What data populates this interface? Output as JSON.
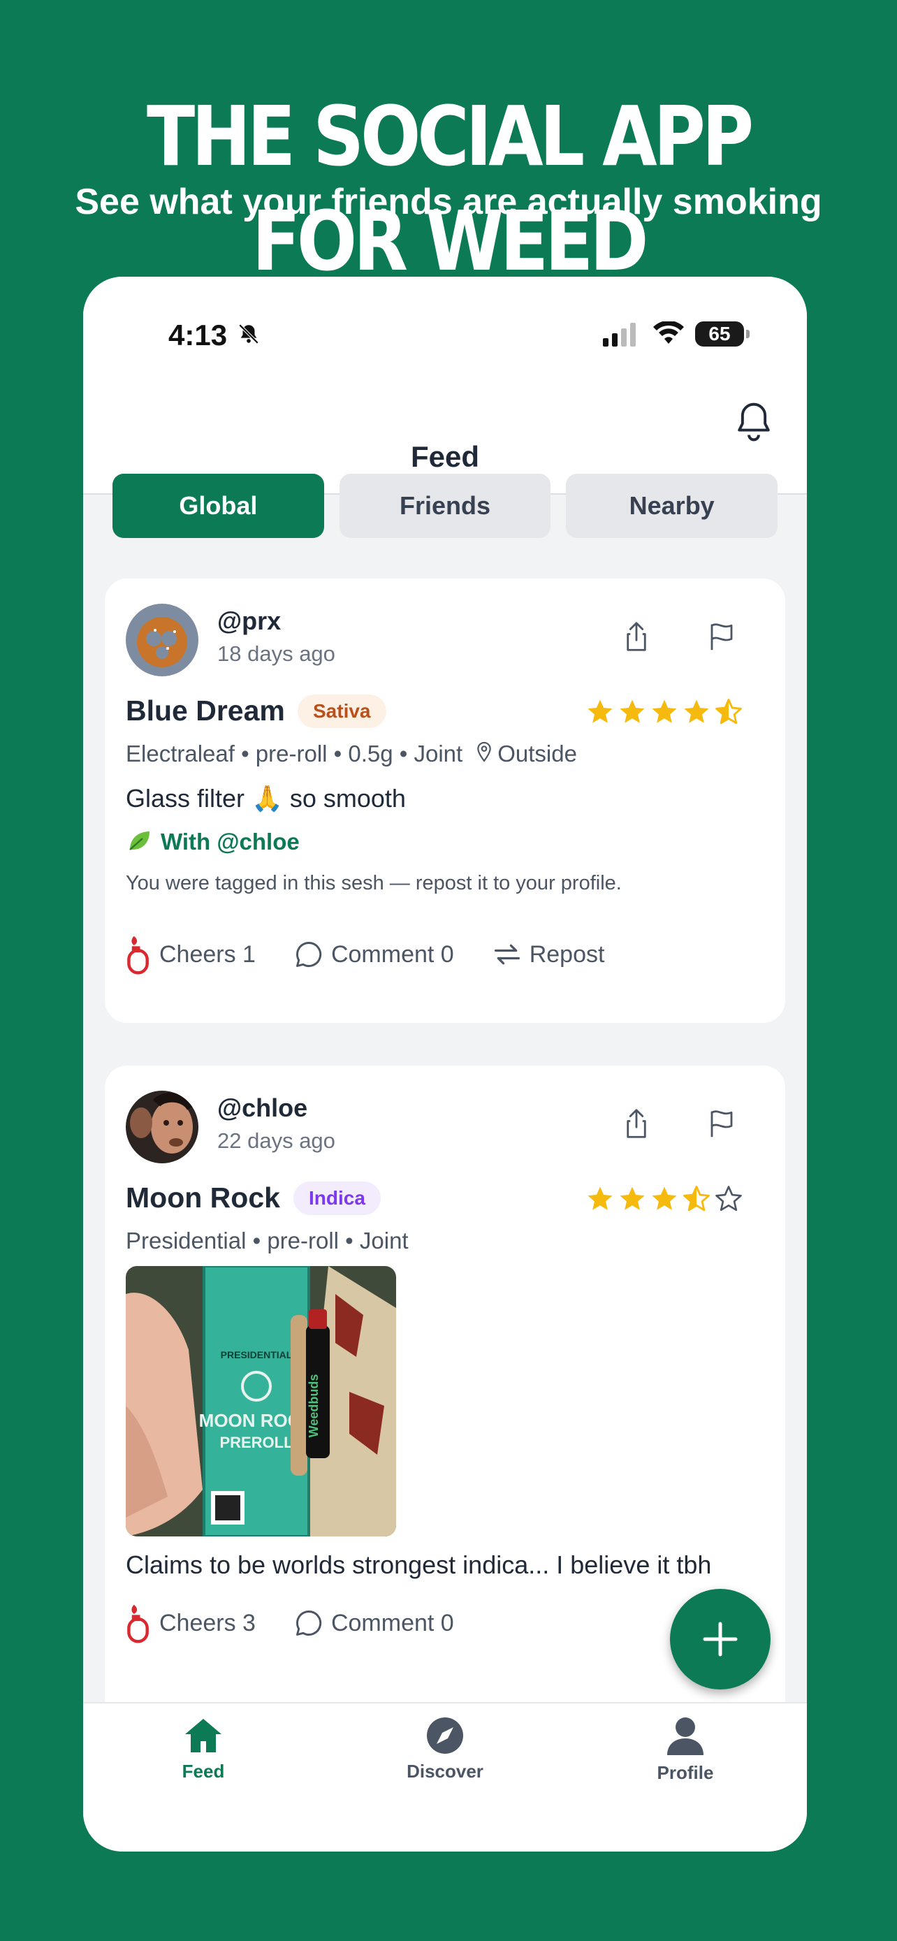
{
  "hero": {
    "title": "THE SOCIAL APP FOR WEED",
    "subtitle": "See what your friends are actually smoking"
  },
  "status_bar": {
    "time": "4:13",
    "battery": "65"
  },
  "header": {
    "title": "Feed"
  },
  "tabs": [
    {
      "label": "Global",
      "active": true
    },
    {
      "label": "Friends",
      "active": false
    },
    {
      "label": "Nearby",
      "active": false
    }
  ],
  "posts": [
    {
      "username": "@prx",
      "time_ago": "18 days ago",
      "strain": "Blue Dream",
      "type_badge": "Sativa",
      "rating": 4.5,
      "meta": "Electraleaf • pre-roll • 0.5g • Joint",
      "location": "Outside",
      "caption": "Glass filter 🙏 so smooth",
      "with_label": "With @chloe",
      "tag_note": "You were tagged in this sesh — repost it to your profile.",
      "cheers_label": "Cheers 1",
      "comment_label": "Comment 0",
      "repost_label": "Repost"
    },
    {
      "username": "@chloe",
      "time_ago": "22 days ago",
      "strain": "Moon Rock",
      "type_badge": "Indica",
      "rating": 3.5,
      "meta": "Presidential • pre-roll • Joint",
      "photo_text": {
        "brand": "PRESIDENTIAL",
        "product": "MOON ROCK",
        "format": "PREROLL",
        "lighter": "Weedbuds"
      },
      "caption": "Claims to be worlds strongest indica... I believe it tbh",
      "cheers_label": "Cheers 3",
      "comment_label": "Comment 0"
    }
  ],
  "bottom_nav": [
    {
      "label": "Feed",
      "icon": "home-icon",
      "active": true
    },
    {
      "label": "Discover",
      "icon": "compass-icon",
      "active": false
    },
    {
      "label": "Profile",
      "icon": "person-icon",
      "active": false
    }
  ],
  "colors": {
    "brand_green": "#0b7a55",
    "star_gold": "#f6b90d",
    "sativa_text": "#b9501c",
    "indica_text": "#7c3aed"
  }
}
